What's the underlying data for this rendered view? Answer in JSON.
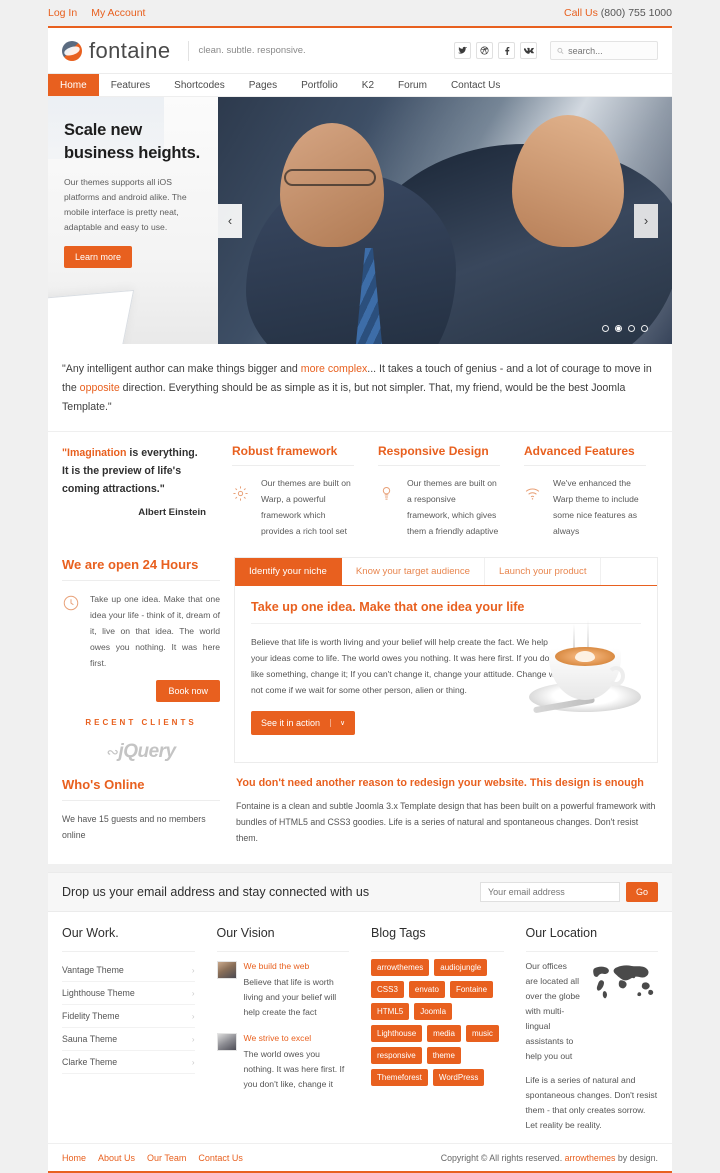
{
  "topbar": {
    "links": [
      {
        "label": "Log In"
      },
      {
        "label": "My Account"
      }
    ],
    "call_label": "Call Us",
    "call_number": "(800) 755 1000"
  },
  "header": {
    "logo_text": "fontaine",
    "tagline": "clean. subtle. responsive.",
    "social": [
      {
        "name": "twitter-icon"
      },
      {
        "name": "dribbble-icon"
      },
      {
        "name": "facebook-icon"
      },
      {
        "name": "vk-icon"
      }
    ],
    "search_placeholder": "search..."
  },
  "nav": {
    "items": [
      {
        "label": "Home",
        "active": true
      },
      {
        "label": "Features",
        "active": false
      },
      {
        "label": "Shortcodes",
        "active": false
      },
      {
        "label": "Pages",
        "active": false
      },
      {
        "label": "Portfolio",
        "active": false
      },
      {
        "label": "K2",
        "active": false
      },
      {
        "label": "Forum",
        "active": false
      },
      {
        "label": "Contact Us",
        "active": false
      }
    ]
  },
  "hero": {
    "title": "Scale new business heights.",
    "text": "Our themes supports all iOS platforms and android alike. The mobile interface is pretty neat, adaptable and easy to use.",
    "button": "Learn more",
    "prev_arrow": "‹",
    "next_arrow": "›",
    "slide_count": 4,
    "active_slide": 2
  },
  "quote_band": {
    "part1": "\"Any intelligent author can make things bigger and ",
    "hl1": "more complex",
    "part2": "... It takes a touch of genius - and a lot of courage to move in the ",
    "hl2": "opposite",
    "part3": " direction. Everything should be as simple as it is, but not simpler. That, my friend, would be the best Joomla Template.\""
  },
  "einstein": {
    "quote_hl": "\"Imagination",
    "quote_rest": " is everything. It is the preview of life's coming attractions.\"",
    "author": "Albert Einstein"
  },
  "features": [
    {
      "title": "Robust framework",
      "text": "Our themes are built on Warp, a powerful framework which provides a rich tool set",
      "icon": "gear-icon"
    },
    {
      "title": "Responsive Design",
      "text": "Our themes are built on a responsive framework, which gives them a friendly adaptive",
      "icon": "bulb-icon"
    },
    {
      "title": "Advanced Features",
      "text": "We've enhanced the Warp theme to include some nice features as always",
      "icon": "wifi-icon"
    }
  ],
  "open_hours": {
    "title": "We are open 24 Hours",
    "text": "Take up one idea. Make that one idea your life - think of it, dream of it, live on that idea. The world owes you nothing. It was here first.",
    "button": "Book now",
    "recent_clients_label": "RECENT CLIENTS",
    "client_logo": "jQuery"
  },
  "tabs": {
    "items": [
      {
        "label": "Identify your niche",
        "active": true
      },
      {
        "label": "Know your target audience",
        "active": false
      },
      {
        "label": "Launch your product",
        "active": false
      }
    ],
    "panel_title": "Take up one idea. Make that one idea your life",
    "panel_text": "Believe that life is worth living and your belief will help create the fact. We help your ideas come to life. The world owes you nothing. It was here first. If you don't like something, change it; If you can't change it, change your attitude. Change will not come if we wait for some other person, alien or thing.",
    "action_button": "See it in action",
    "action_caret": "∨"
  },
  "whos_online": {
    "title": "Who's Online",
    "text": "We have 15 guests and no members online"
  },
  "redesign": {
    "title": "You don't need another reason to redesign your website. This design is enough",
    "text": "Fontaine is a clean and subtle Joomla 3.x Template design that has been built on a powerful framework with bundles of HTML5 and CSS3 goodies. Life is a series of natural and spontaneous changes. Don't resist them."
  },
  "newsletter": {
    "title": "Drop us your email address and stay connected with us",
    "placeholder": "Your email address",
    "button": "Go"
  },
  "footer": {
    "work": {
      "title": "Our Work.",
      "items": [
        {
          "label": "Vantage Theme"
        },
        {
          "label": "Lighthouse Theme"
        },
        {
          "label": "Fidelity Theme"
        },
        {
          "label": "Sauna Theme"
        },
        {
          "label": "Clarke Theme"
        }
      ],
      "chevron": "›"
    },
    "vision": {
      "title": "Our Vision",
      "items": [
        {
          "link": "We build the web",
          "text": "Believe that life is worth living and your belief will help create the fact"
        },
        {
          "link": "We strive to excel",
          "text": "The world owes you nothing. It was here first. If you don't like, change it"
        }
      ]
    },
    "blog_tags": {
      "title": "Blog Tags",
      "tags": [
        "arrowthemes",
        "audiojungle",
        "CSS3",
        "envato",
        "Fontaine",
        "HTML5",
        "Joomla",
        "Lighthouse",
        "media",
        "music",
        "responsive",
        "theme",
        "Themeforest",
        "WordPress"
      ]
    },
    "location": {
      "title": "Our Location",
      "text_top": "Our offices are located all over the globe with multi-lingual assistants to help you out",
      "text_bottom": "Life is a series of natural and spontaneous changes. Don't resist them - that only creates sorrow. Let reality be reality."
    },
    "bottom_links": [
      {
        "label": "Home"
      },
      {
        "label": "About Us"
      },
      {
        "label": "Our Team"
      },
      {
        "label": "Contact Us"
      }
    ],
    "copyright_pre": "Copyright © All rights reserved. ",
    "copyright_link": "arrowthemes",
    "copyright_post": " by design."
  },
  "colors": {
    "accent": "#e8601f",
    "page_bg": "#f0f0f0",
    "card_bg": "#ffffff"
  }
}
